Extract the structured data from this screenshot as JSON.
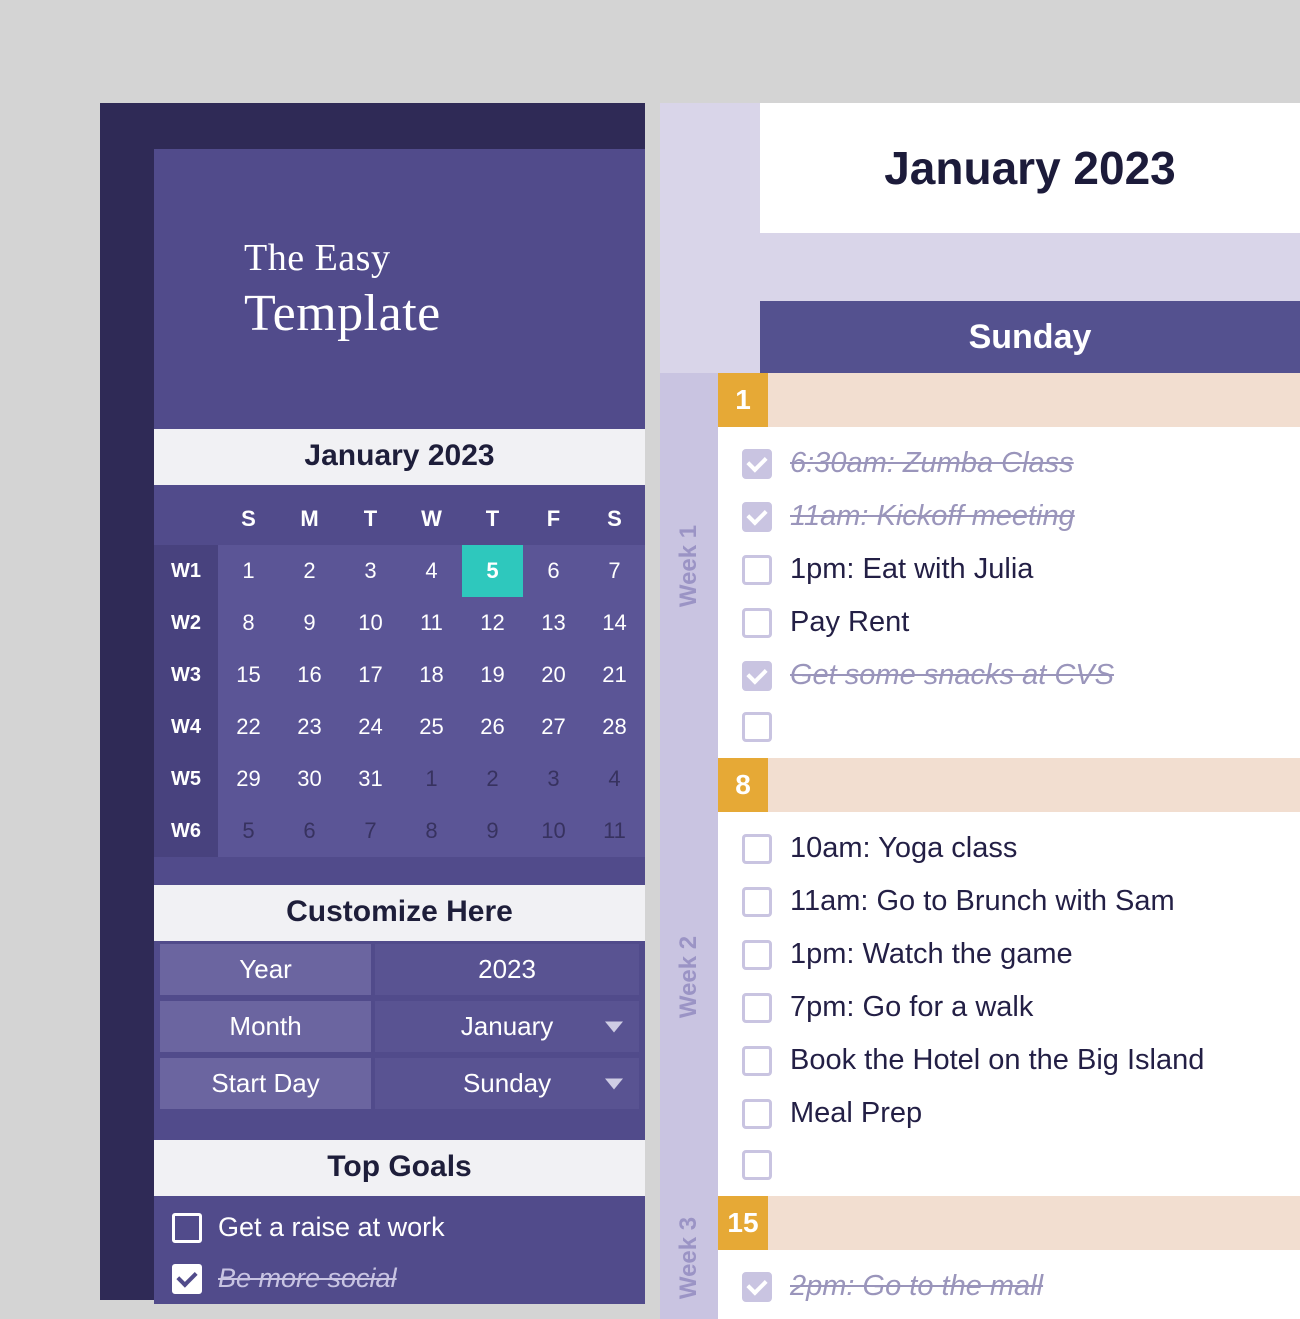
{
  "brand": {
    "line1": "The Easy",
    "line2": "Template"
  },
  "mini_calendar": {
    "title": "January 2023",
    "dow": [
      "S",
      "M",
      "T",
      "W",
      "T",
      "F",
      "S"
    ],
    "weeks": [
      {
        "wk": "W1",
        "days": [
          {
            "n": "1"
          },
          {
            "n": "2"
          },
          {
            "n": "3"
          },
          {
            "n": "4"
          },
          {
            "n": "5",
            "today": true
          },
          {
            "n": "6"
          },
          {
            "n": "7"
          }
        ]
      },
      {
        "wk": "W2",
        "days": [
          {
            "n": "8"
          },
          {
            "n": "9"
          },
          {
            "n": "10"
          },
          {
            "n": "11"
          },
          {
            "n": "12"
          },
          {
            "n": "13"
          },
          {
            "n": "14"
          }
        ]
      },
      {
        "wk": "W3",
        "days": [
          {
            "n": "15"
          },
          {
            "n": "16"
          },
          {
            "n": "17"
          },
          {
            "n": "18"
          },
          {
            "n": "19"
          },
          {
            "n": "20"
          },
          {
            "n": "21"
          }
        ]
      },
      {
        "wk": "W4",
        "days": [
          {
            "n": "22"
          },
          {
            "n": "23"
          },
          {
            "n": "24"
          },
          {
            "n": "25"
          },
          {
            "n": "26"
          },
          {
            "n": "27"
          },
          {
            "n": "28"
          }
        ]
      },
      {
        "wk": "W5",
        "days": [
          {
            "n": "29"
          },
          {
            "n": "30"
          },
          {
            "n": "31"
          },
          {
            "n": "1",
            "muted": true
          },
          {
            "n": "2",
            "muted": true
          },
          {
            "n": "3",
            "muted": true
          },
          {
            "n": "4",
            "muted": true
          }
        ]
      },
      {
        "wk": "W6",
        "days": [
          {
            "n": "5",
            "muted": true
          },
          {
            "n": "6",
            "muted": true
          },
          {
            "n": "7",
            "muted": true
          },
          {
            "n": "8",
            "muted": true
          },
          {
            "n": "9",
            "muted": true
          },
          {
            "n": "10",
            "muted": true
          },
          {
            "n": "11",
            "muted": true
          }
        ]
      }
    ]
  },
  "customize": {
    "title": "Customize Here",
    "rows": [
      {
        "label": "Year",
        "value": "2023",
        "dropdown": false
      },
      {
        "label": "Month",
        "value": "January",
        "dropdown": true
      },
      {
        "label": "Start Day",
        "value": "Sunday",
        "dropdown": true
      }
    ]
  },
  "goals": {
    "title": "Top Goals",
    "items": [
      {
        "text": "Get a raise at work",
        "done": false
      },
      {
        "text": "Be more social",
        "done": true
      }
    ]
  },
  "planner": {
    "month_title": "January 2023",
    "day_column": "Sunday",
    "weeks": [
      {
        "label": "Week 1",
        "day_number": "1",
        "tasks": [
          {
            "text": "6:30am: Zumba Class",
            "done": true
          },
          {
            "text": "11am: Kickoff meeting",
            "done": true
          },
          {
            "text": "1pm: Eat with Julia",
            "done": false
          },
          {
            "text": "Pay Rent",
            "done": false
          },
          {
            "text": "Get some snacks at CVS",
            "done": true
          },
          {
            "text": "",
            "done": false
          }
        ]
      },
      {
        "label": "Week 2",
        "day_number": "8",
        "tasks": [
          {
            "text": "10am: Yoga class",
            "done": false
          },
          {
            "text": "11am: Go to Brunch with Sam",
            "done": false
          },
          {
            "text": "1pm: Watch the game",
            "done": false
          },
          {
            "text": "7pm: Go for a walk",
            "done": false
          },
          {
            "text": "Book the Hotel on the Big Island",
            "done": false
          },
          {
            "text": "Meal Prep",
            "done": false
          },
          {
            "text": "",
            "done": false
          }
        ]
      },
      {
        "label": "Week 3",
        "day_number": "15",
        "tasks": [
          {
            "text": "2pm: Go to the mall",
            "done": true
          }
        ]
      }
    ]
  }
}
